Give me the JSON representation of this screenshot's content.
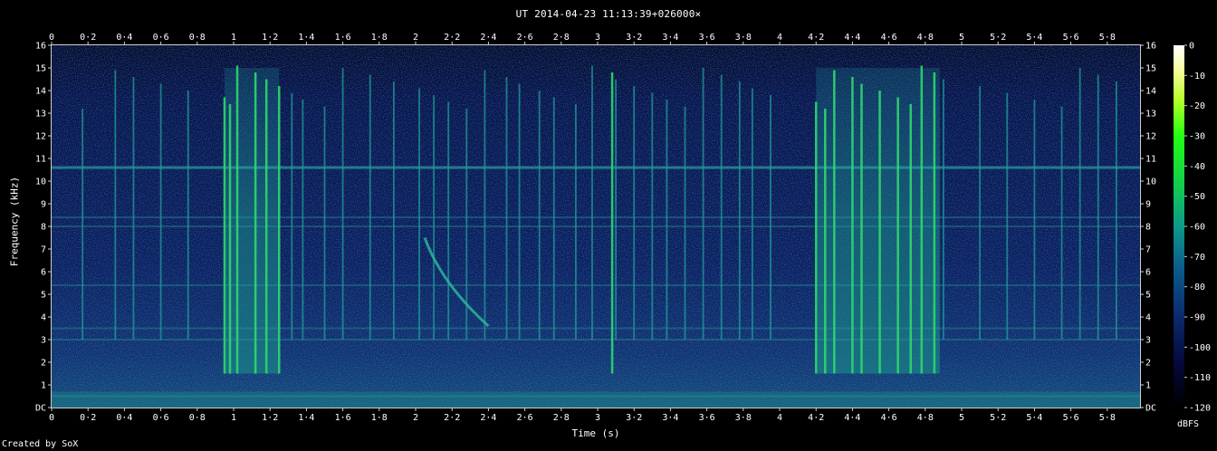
{
  "title": "UT 2014-04-23 11:13:39+026000×",
  "credit": "Created by SoX",
  "chart_data": {
    "type": "heatmap",
    "xlabel": "Time (s)",
    "ylabel": "Frequency (kHz)",
    "colorbar_label": "dBFS",
    "xlim": [
      0,
      5.98
    ],
    "ylim": [
      0,
      16
    ],
    "x_ticks": [
      "0",
      "0·2",
      "0·4",
      "0·6",
      "0·8",
      "1",
      "1·2",
      "1·4",
      "1·6",
      "1·8",
      "2",
      "2·2",
      "2·4",
      "2·6",
      "2·8",
      "3",
      "3·2",
      "3·4",
      "3·6",
      "3·8",
      "4",
      "4·2",
      "4·4",
      "4·6",
      "4·8",
      "5",
      "5·2",
      "5·4",
      "5·6",
      "5·8"
    ],
    "x_tick_values": [
      0,
      0.2,
      0.4,
      0.6,
      0.8,
      1,
      1.2,
      1.4,
      1.6,
      1.8,
      2,
      2.2,
      2.4,
      2.6,
      2.8,
      3,
      3.2,
      3.4,
      3.6,
      3.8,
      4,
      4.2,
      4.4,
      4.6,
      4.8,
      5,
      5.2,
      5.4,
      5.6,
      5.8
    ],
    "y_ticks": [
      "DC",
      "1",
      "2",
      "3",
      "4",
      "5",
      "6",
      "7",
      "8",
      "9",
      "10",
      "11",
      "12",
      "13",
      "14",
      "15",
      "16"
    ],
    "colorbar_ticks": [
      "0",
      "-10",
      "-20",
      "-30",
      "-40",
      "-50",
      "-60",
      "-70",
      "-80",
      "-90",
      "-100",
      "-110",
      "-120"
    ],
    "colorbar_range": [
      -120,
      0
    ],
    "features": {
      "constant_tones_khz": [
        10.6,
        8.4,
        8.0,
        5.4,
        3.5,
        3.0,
        0.5
      ],
      "impulses_s": [
        0.17,
        0.35,
        0.45,
        0.6,
        0.75,
        0.95,
        0.98,
        1.02,
        1.12,
        1.18,
        1.25,
        1.32,
        1.38,
        1.5,
        1.6,
        1.75,
        1.88,
        2.02,
        2.1,
        2.18,
        2.28,
        2.38,
        2.5,
        2.57,
        2.68,
        2.76,
        2.88,
        2.97,
        3.08,
        3.1,
        3.2,
        3.3,
        3.38,
        3.48,
        3.58,
        3.68,
        3.78,
        3.85,
        3.95,
        4.2,
        4.25,
        4.3,
        4.4,
        4.45,
        4.55,
        4.65,
        4.72,
        4.78,
        4.85,
        4.9,
        5.1,
        5.25,
        5.4,
        5.55,
        5.65,
        5.75,
        5.85
      ],
      "sweep": {
        "t_start": 2.05,
        "f_start": 7.5,
        "t_end": 2.4,
        "f_end": 3.6
      },
      "broadband_bursts_s": [
        [
          0.95,
          1.25
        ],
        [
          4.2,
          4.88
        ]
      ]
    }
  }
}
